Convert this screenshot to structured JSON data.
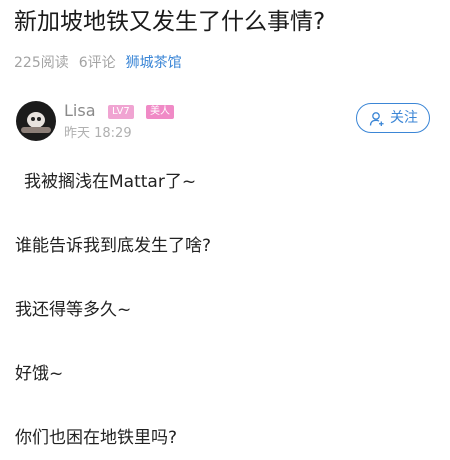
{
  "post": {
    "title": "新加坡地铁又发生了什么事情?",
    "stats": {
      "views": "225阅读",
      "comments": "6评论",
      "forum": "狮城茶馆"
    },
    "author": {
      "name": "Lisa",
      "level": "LV7",
      "role": "美人",
      "time": "昨天 18:29"
    },
    "follow_label": "关注",
    "lines": [
      "我被搁浅在Mattar了~",
      "谁能告诉我到底发生了啥?",
      "我还得等多久~",
      "好饿~",
      "你们也困在地铁里吗?"
    ]
  },
  "colors": {
    "accent": "#3b86d6",
    "badge_pink": "#f08ac6",
    "muted": "#a3a3a3"
  }
}
